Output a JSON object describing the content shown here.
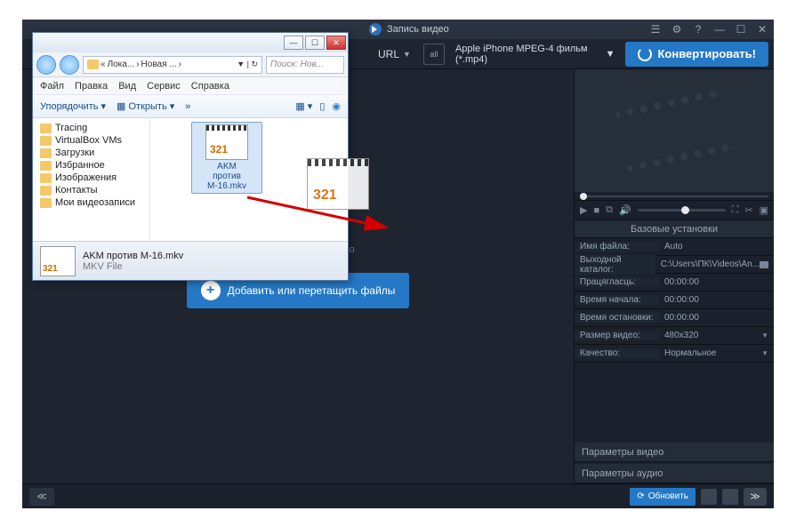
{
  "app": {
    "rec_tab": "Запись видео",
    "url_label": "URL",
    "all_label": "all",
    "preset": "Apple iPhone MPEG-4 фильм (*.mp4)",
    "convert": "Конвертировать!",
    "hint": "ы для добавления видео",
    "add_btn": "Добавить или перетащить файлы"
  },
  "settings": {
    "header": "Базовые установки",
    "filename_l": "Имя файла:",
    "filename_v": "Auto",
    "outdir_l": "Выходной каталог:",
    "outdir_v": "C:\\Users\\ПК\\Videos\\An...",
    "dur_l": "Працягласць:",
    "dur_v": "00:00:00",
    "start_l": "Время начала:",
    "start_v": "00:00:00",
    "stop_l": "Время остановки:",
    "stop_v": "00:00:00",
    "size_l": "Размер видео:",
    "size_v": "480x320",
    "quality_l": "Качество:",
    "quality_v": "Нормальное",
    "video_params": "Параметры видео",
    "audio_params": "Параметры аудио"
  },
  "footer": {
    "update": "Обновить"
  },
  "explorer": {
    "bc1": "Лока...",
    "bc2": "Новая ...",
    "search_ph": "Поиск: Нов...",
    "menu": [
      "Файл",
      "Правка",
      "Вид",
      "Сервис",
      "Справка"
    ],
    "organize": "Упорядочить",
    "open": "Открыть",
    "tree": [
      "Tracing",
      "VirtualBox VMs",
      "Загрузки",
      "Избранное",
      "Изображения",
      "Контакты",
      "Мои видеозаписи"
    ],
    "file": "AKM против M-16.mkv",
    "file_lines": [
      "AKM",
      "против",
      "M-16.mkv"
    ],
    "status_name": "AKM против M-16.mkv",
    "status_type": "MKV File"
  }
}
